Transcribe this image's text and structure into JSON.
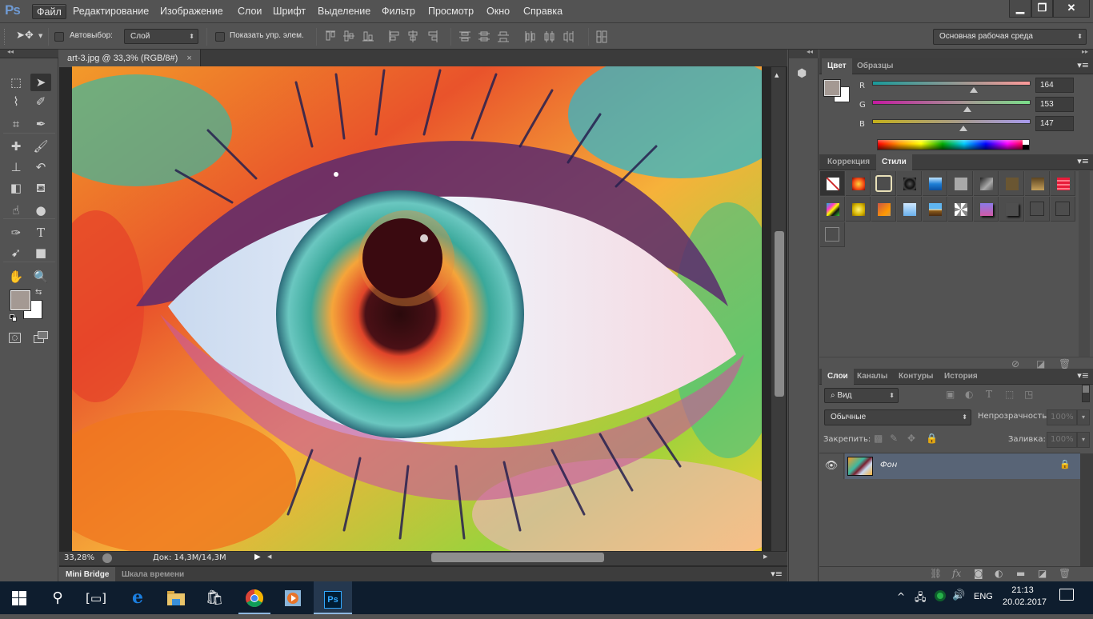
{
  "app": {
    "logo": "Ps",
    "name": "Adobe Photoshop"
  },
  "menubar": {
    "items": [
      "Файл",
      "Редактирование",
      "Изображение",
      "Слои",
      "Шрифт",
      "Выделение",
      "Фильтр",
      "Просмотр",
      "Окно",
      "Справка"
    ],
    "active_index": 0
  },
  "window_controls": {
    "minimize": "minimize-icon",
    "restore": "restore-icon",
    "close": "close-icon"
  },
  "options_bar": {
    "tool_icon": "move-tool-icon",
    "autoselect_label": "Автовыбор:",
    "autoselect_checked": false,
    "autoselect_target": "Слой",
    "show_transform_label": "Показать упр. элем.",
    "show_transform_checked": false,
    "workspace": "Основная рабочая среда"
  },
  "document": {
    "tab_title": "art-3.jpg @ 33,3% (RGB/8#)",
    "close_glyph": "×",
    "zoom": "33,28%",
    "doc_size": "Док: 14,3M/14,3M"
  },
  "bottom_tabs": [
    "Mini Bridge",
    "Шкала времени"
  ],
  "tools": [
    [
      "rectangular-marquee-tool",
      "move-tool"
    ],
    [
      "polygonal-lasso-tool",
      "quick-selection-tool"
    ],
    [
      "crop-tool",
      "eyedropper-tool"
    ],
    [
      "spot-healing-brush-tool",
      "brush-tool"
    ],
    [
      "clone-stamp-tool",
      "history-brush-tool"
    ],
    [
      "eraser-tool",
      "paint-bucket-tool"
    ],
    [
      "smudge-tool",
      "dodge-tool"
    ],
    [
      "pen-tool",
      "type-tool"
    ],
    [
      "path-selection-tool",
      "rectangle-tool"
    ],
    [
      "hand-tool",
      "zoom-tool"
    ]
  ],
  "colors": {
    "foreground": "#a49993",
    "background": "#ffffff",
    "accent": "#6f9ad3"
  },
  "color_panel": {
    "tabs": [
      "Цвет",
      "Образцы"
    ],
    "active_tab": 0,
    "channels": [
      {
        "label": "R",
        "value": "164",
        "fraction": 0.643
      },
      {
        "label": "G",
        "value": "153",
        "fraction": 0.6
      },
      {
        "label": "B",
        "value": "147",
        "fraction": 0.576
      }
    ]
  },
  "styles_panel": {
    "tabs": [
      "Коррекция",
      "Стили"
    ],
    "active_tab": 1,
    "styles": [
      "none-style",
      "red-glow",
      "outline-beige",
      "black-chrome",
      "blue-glass",
      "gray-flat",
      "gray-gradient",
      "brown-dark",
      "brown-gradient",
      "red-stripes",
      "rainbow",
      "yellow-bevel",
      "orange-gradient",
      "blue-gradient",
      "landscape",
      "noise",
      "purple-shadow",
      "gray-drop",
      "gray-outline",
      "gray-outline-2",
      "empty-outline"
    ]
  },
  "styles_footer": [
    "clear-style-icon",
    "new-style-icon",
    "delete-icon"
  ],
  "layers_panel": {
    "tabs": [
      "Слои",
      "Каналы",
      "Контуры",
      "История"
    ],
    "active_tab": 0,
    "filter_label": "Вид",
    "blend_mode": "Обычные",
    "opacity_label": "Непрозрачность:",
    "opacity_value": "100%",
    "lock_label": "Закрепить:",
    "fill_label": "Заливка:",
    "fill_value": "100%",
    "layers": [
      {
        "name": "Фон",
        "visible": true,
        "locked": true,
        "selected": true
      }
    ],
    "footer_icons": [
      "link-layers-icon",
      "fx-icon",
      "mask-icon",
      "adjustment-icon",
      "group-icon",
      "new-layer-icon",
      "delete-icon"
    ]
  },
  "taskbar": {
    "apps": [
      "start",
      "search",
      "task-view",
      "edge",
      "file-explorer",
      "store",
      "chrome",
      "media-player",
      "photoshop"
    ],
    "tray_lang": "ENG",
    "time": "21:13",
    "date": "20.02.2017"
  }
}
